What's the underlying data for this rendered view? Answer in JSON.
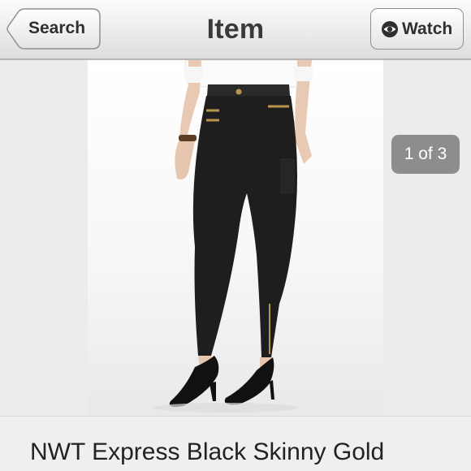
{
  "nav": {
    "title": "Item",
    "back_label": "Search",
    "watch_label": "Watch",
    "watch_icon": "eye-icon"
  },
  "gallery": {
    "counter": "1 of 3"
  },
  "listing": {
    "title": "NWT Express Black Skinny Gold"
  },
  "colors": {
    "nav_bg_top": "#fbfbfb",
    "nav_bg_bottom": "#dedede",
    "badge_bg": "#8d8d8d",
    "text": "#222222"
  }
}
